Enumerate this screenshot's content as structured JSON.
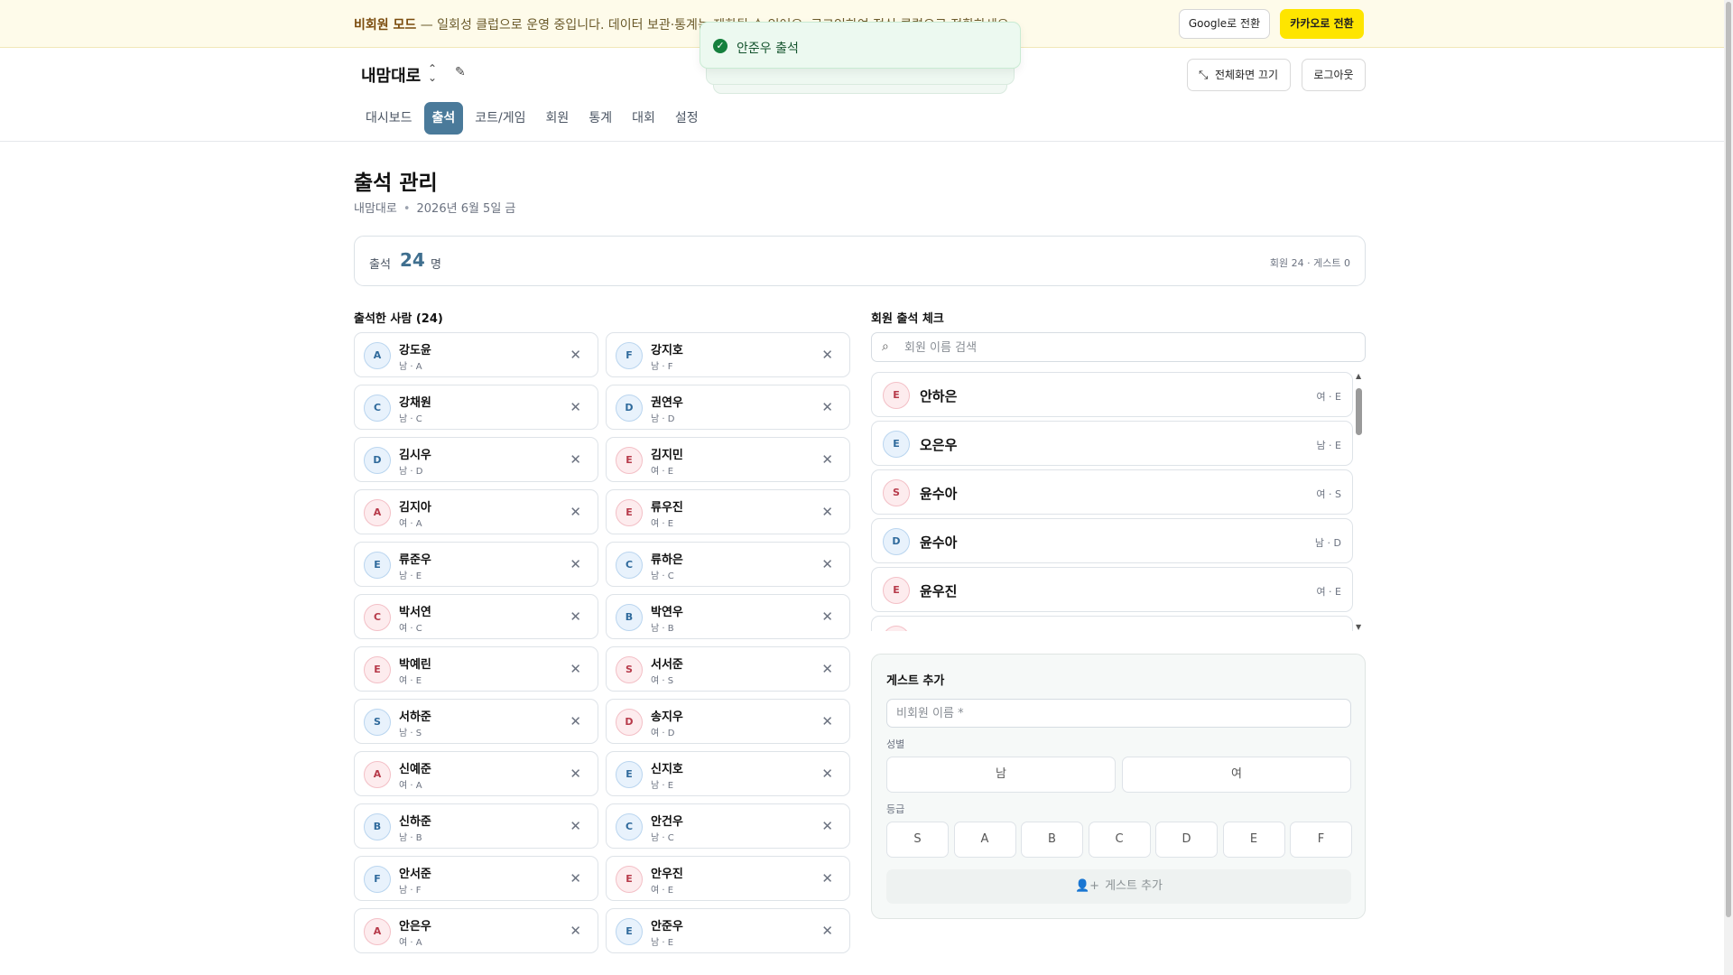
{
  "banner": {
    "mode_label": "비회원 모드",
    "message": " — 일회성 클럽으로 운영 중입니다. 데이터 보관·통계는 제한될 수 있어요. 로그인하여 정식 클럽으로 전환하세요.",
    "google_button": "Google로 전환",
    "kakao_button": "카카오로 전환"
  },
  "header": {
    "club_name": "내맘대로",
    "fullscreen_button": "전체화면 끄기",
    "logout_button": "로그아웃",
    "tabs": [
      {
        "label": "대시보드",
        "active": false
      },
      {
        "label": "출석",
        "active": true
      },
      {
        "label": "코트/게임",
        "active": false
      },
      {
        "label": "회원",
        "active": false
      },
      {
        "label": "통계",
        "active": false
      },
      {
        "label": "대회",
        "active": false
      },
      {
        "label": "설정",
        "active": false
      }
    ]
  },
  "toast": {
    "message": "안준우 출석",
    "color": "#15803d"
  },
  "main": {
    "title": "출석 관리",
    "club": "내맘대로",
    "date": "2026년 6월 5일 금",
    "count_label": "출석",
    "count_value": "24",
    "count_unit": "명",
    "count_breakdown": "회원 24 · 게스트 0"
  },
  "attendees": {
    "title": "출석한 사람 (24)",
    "items": [
      {
        "name": "강도윤",
        "meta": "남 · A",
        "grade": "A",
        "gender": "m"
      },
      {
        "name": "강지호",
        "meta": "남 · F",
        "grade": "F",
        "gender": "m"
      },
      {
        "name": "강채원",
        "meta": "남 · C",
        "grade": "C",
        "gender": "m"
      },
      {
        "name": "권연우",
        "meta": "남 · D",
        "grade": "D",
        "gender": "m"
      },
      {
        "name": "김시우",
        "meta": "남 · D",
        "grade": "D",
        "gender": "m"
      },
      {
        "name": "김지민",
        "meta": "여 · E",
        "grade": "E",
        "gender": "f"
      },
      {
        "name": "김지아",
        "meta": "여 · A",
        "grade": "A",
        "gender": "f"
      },
      {
        "name": "류우진",
        "meta": "여 · E",
        "grade": "E",
        "gender": "f"
      },
      {
        "name": "류준우",
        "meta": "남 · E",
        "grade": "E",
        "gender": "m"
      },
      {
        "name": "류하은",
        "meta": "남 · C",
        "grade": "C",
        "gender": "m"
      },
      {
        "name": "박서연",
        "meta": "여 · C",
        "grade": "C",
        "gender": "f"
      },
      {
        "name": "박연우",
        "meta": "남 · B",
        "grade": "B",
        "gender": "m"
      },
      {
        "name": "박예린",
        "meta": "여 · E",
        "grade": "E",
        "gender": "f"
      },
      {
        "name": "서서준",
        "meta": "여 · S",
        "grade": "S",
        "gender": "f"
      },
      {
        "name": "서하준",
        "meta": "남 · S",
        "grade": "S",
        "gender": "m"
      },
      {
        "name": "송지우",
        "meta": "여 · D",
        "grade": "D",
        "gender": "f"
      },
      {
        "name": "신예준",
        "meta": "여 · A",
        "grade": "A",
        "gender": "f"
      },
      {
        "name": "신지호",
        "meta": "남 · E",
        "grade": "E",
        "gender": "m"
      },
      {
        "name": "신하준",
        "meta": "남 · B",
        "grade": "B",
        "gender": "m"
      },
      {
        "name": "안건우",
        "meta": "남 · C",
        "grade": "C",
        "gender": "m"
      },
      {
        "name": "안서준",
        "meta": "남 · F",
        "grade": "F",
        "gender": "m"
      },
      {
        "name": "안우진",
        "meta": "여 · E",
        "grade": "E",
        "gender": "f"
      },
      {
        "name": "안은우",
        "meta": "여 · A",
        "grade": "A",
        "gender": "f"
      },
      {
        "name": "안준우",
        "meta": "남 · E",
        "grade": "E",
        "gender": "m"
      }
    ]
  },
  "member_check": {
    "title": "회원 출석 체크",
    "search_placeholder": "회원 이름 검색",
    "items": [
      {
        "name": "안하은",
        "meta": "여 · E",
        "grade": "E",
        "gender": "f"
      },
      {
        "name": "오은우",
        "meta": "남 · E",
        "grade": "E",
        "gender": "m"
      },
      {
        "name": "윤수아",
        "meta": "여 · S",
        "grade": "S",
        "gender": "f"
      },
      {
        "name": "윤수아",
        "meta": "남 · D",
        "grade": "D",
        "gender": "m"
      },
      {
        "name": "윤우진",
        "meta": "여 · E",
        "grade": "E",
        "gender": "f"
      },
      {
        "name": "",
        "meta": "",
        "grade": "",
        "gender": "f"
      }
    ]
  },
  "guest": {
    "title": "게스트 추가",
    "name_placeholder": "비회원 이름 *",
    "gender_label": "성별",
    "gender_options": [
      "남",
      "여"
    ],
    "grade_label": "등급",
    "grade_options": [
      "S",
      "A",
      "B",
      "C",
      "D",
      "E",
      "F"
    ],
    "add_button": "게스트 추가"
  },
  "colors": {
    "accent": "#4a7a9a",
    "kakao": "#fee500",
    "banner_bg": "#fefbea",
    "toast_bg": "#ecf9f0"
  }
}
